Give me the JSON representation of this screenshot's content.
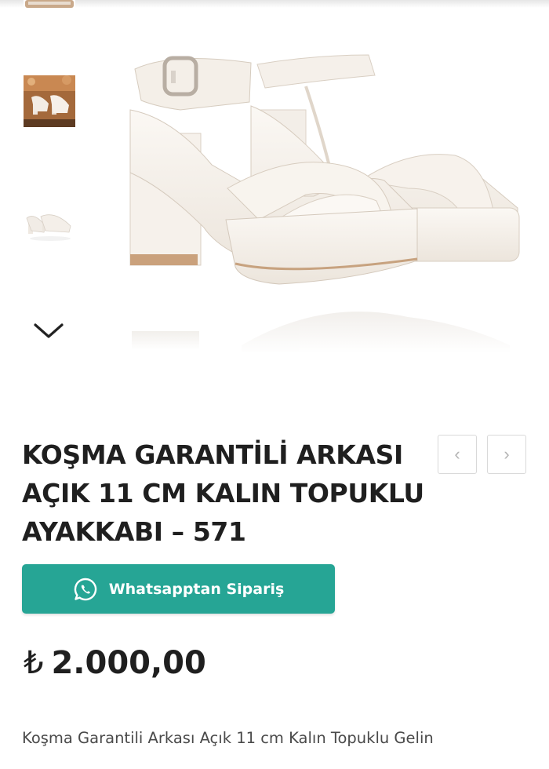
{
  "gallery": {
    "thumbnails": [
      {
        "icon": "sandal-thumbnail-partial",
        "selected": false
      },
      {
        "icon": "sandal-thumbnail-beige-background",
        "selected": false
      },
      {
        "icon": "sandal-thumbnail-white",
        "selected": true
      }
    ],
    "next_icon": "chevron-down-icon",
    "main_image_icon": "white-platform-sandal-image"
  },
  "product": {
    "title": "KOŞMA GARANTİLİ ARKASI AÇIK 11 CM KALIN TOPUKLU AYAKKABI – 571",
    "nav": {
      "prev_glyph": "‹",
      "next_glyph": "›"
    },
    "whatsapp_label": "Whatsapptan Sipariş",
    "price_currency": "₺",
    "price_value": "2.000,00",
    "description": "Koşma Garantili Arkası Açık 11 cm Kalın Topuklu Gelin"
  },
  "colors": {
    "whatsapp_button": "#26a595",
    "text": "#1f1f1f",
    "nav_border": "#d9d9d9"
  }
}
